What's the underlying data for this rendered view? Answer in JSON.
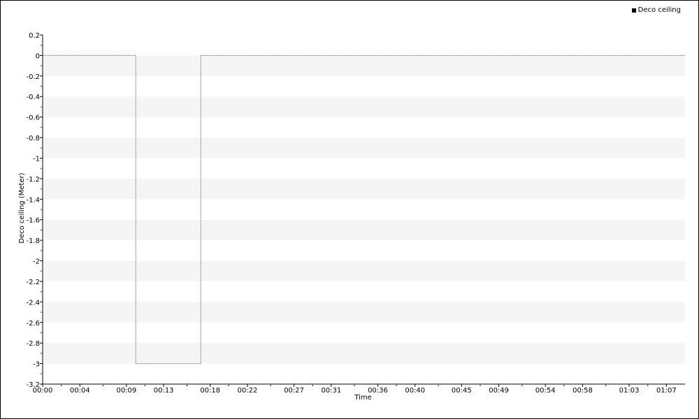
{
  "chart_data": {
    "type": "line",
    "title": "",
    "xlabel": "Time",
    "ylabel": "Deco ceiling (Meter)",
    "legend": {
      "position": "top-right",
      "entries": [
        "Deco ceiling"
      ]
    },
    "grid": "alternating horizontal bands",
    "xlim": [
      "00:00",
      "01:09"
    ],
    "ylim": [
      -3.2,
      0.2
    ],
    "x_ticks": [
      "00:00",
      "00:04",
      "00:09",
      "00:13",
      "00:18",
      "00:22",
      "00:27",
      "00:31",
      "00:36",
      "00:40",
      "00:45",
      "00:49",
      "00:54",
      "00:58",
      "01:03",
      "01:07"
    ],
    "y_ticks": [
      "0.2",
      "0",
      "-0.2",
      "-0.4",
      "-0.6",
      "-0.8",
      "-1",
      "-1.2",
      "-1.4",
      "-1.6",
      "-1.8",
      "-2",
      "-2.2",
      "-2.4",
      "-2.6",
      "-2.8",
      "-3",
      "-3.2"
    ],
    "series": [
      {
        "name": "Deco ceiling",
        "color": "#555555",
        "points": [
          {
            "x": "00:00",
            "y": 0
          },
          {
            "x": "00:10",
            "y": 0
          },
          {
            "x": "00:10",
            "y": -3
          },
          {
            "x": "00:17",
            "y": -3
          },
          {
            "x": "00:17",
            "y": 0
          },
          {
            "x": "01:09",
            "y": 0
          }
        ]
      }
    ]
  }
}
